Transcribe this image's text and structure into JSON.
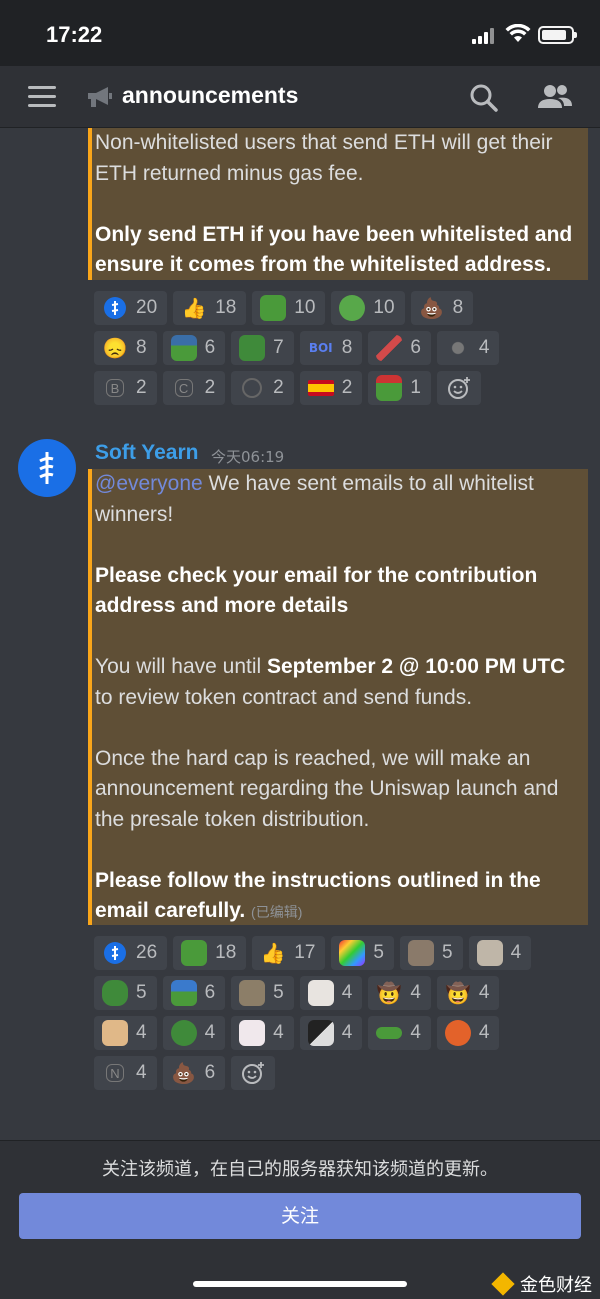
{
  "status_bar": {
    "time": "17:22"
  },
  "header": {
    "channel_name": "announcements"
  },
  "messages": {
    "first": {
      "line1": "Non-whitelisted users that send ETH will get their",
      "line2": "ETH returned minus gas fee.",
      "bold1": "Only send ETH if you have been whitelisted and",
      "bold2": "ensure it comes from the whitelisted address."
    },
    "second": {
      "username": "Soft Yearn",
      "timestamp": "今天06:19",
      "mention": "@everyone",
      "l1_rest": " We have sent emails to all whitelist",
      "l2": "winners!",
      "b1": "Please check your email for the contribution",
      "b2": "address and more details",
      "p3_a": "You will have until ",
      "p3_bold": "September 2 @ 10:00 PM UTC",
      "p3_b": "to review token contract and send funds.",
      "p4_1": "Once the hard cap is reached, we will make an",
      "p4_2": "announcement regarding the Uniswap launch and",
      "p4_3": "the presale token distribution.",
      "b3": "Please follow the instructions outlined in the",
      "b4": "email carefully.",
      "edited": "(已编辑)"
    }
  },
  "reactions_first": [
    [
      {
        "icon": "softyearn-icon",
        "count": "20"
      },
      {
        "icon": "thumbs-up-icon",
        "count": "18"
      },
      {
        "icon": "pepe-scream-icon",
        "count": "10"
      },
      {
        "icon": "pepe-icon",
        "count": "10"
      },
      {
        "icon": "poop-icon",
        "count": "8"
      }
    ],
    [
      {
        "icon": "disappointed-icon",
        "count": "8"
      },
      {
        "icon": "pepe-hat-icon",
        "count": "6"
      },
      {
        "icon": "pepe-money-icon",
        "count": "7"
      },
      {
        "icon": "boi-icon",
        "count": "8"
      },
      {
        "icon": "rocket-icon",
        "count": "6"
      },
      {
        "icon": "gray-emote-icon",
        "count": "4"
      }
    ],
    [
      {
        "icon": "letter-b-icon",
        "count": "2"
      },
      {
        "icon": "letter-c-icon",
        "count": "2"
      },
      {
        "icon": "circle-emote-icon",
        "count": "2"
      },
      {
        "icon": "spain-flag-icon",
        "count": "2"
      },
      {
        "icon": "pepe-flag-icon",
        "count": "1"
      }
    ]
  ],
  "reactions_second": [
    [
      {
        "icon": "softyearn-icon",
        "count": "26"
      },
      {
        "icon": "pepe-scream-icon",
        "count": "18"
      },
      {
        "icon": "thumbs-up-icon",
        "count": "17"
      },
      {
        "icon": "rainbow-pepe-icon",
        "count": "5"
      },
      {
        "icon": "cat-hug-icon",
        "count": "5"
      },
      {
        "icon": "cat-face-icon",
        "count": "4"
      }
    ],
    [
      {
        "icon": "pepe-dance-icon",
        "count": "5"
      },
      {
        "icon": "pepe-umbrella-icon",
        "count": "6"
      },
      {
        "icon": "cat-gray-icon",
        "count": "5"
      },
      {
        "icon": "white-cat-icon",
        "count": "4"
      },
      {
        "icon": "cowboy-icon",
        "count": "4"
      },
      {
        "icon": "cowboy-2-icon",
        "count": "4"
      }
    ],
    [
      {
        "icon": "bread-cat-icon",
        "count": "4"
      },
      {
        "icon": "frog-icon",
        "count": "4"
      },
      {
        "icon": "bunny-icon",
        "count": "4"
      },
      {
        "icon": "black-cat-icon",
        "count": "4"
      },
      {
        "icon": "pepe-lay-icon",
        "count": "4"
      },
      {
        "icon": "pepe-mask-icon",
        "count": "4"
      }
    ],
    [
      {
        "icon": "letter-n-icon",
        "count": "4"
      },
      {
        "icon": "poop-icon",
        "count": "6"
      }
    ]
  ],
  "footer": {
    "note": "关注该频道，在自己的服务器获知该频道的更新。",
    "follow_label": "关注",
    "watermark": "金色财经"
  }
}
